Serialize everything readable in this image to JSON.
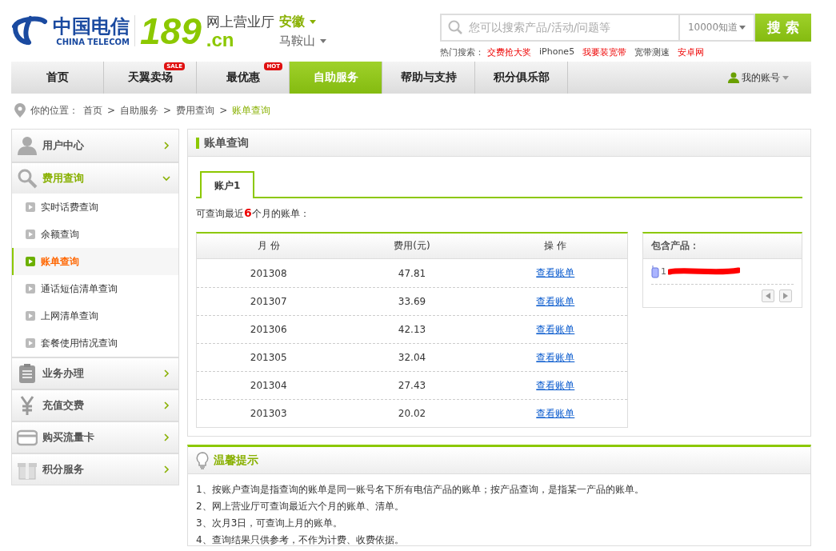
{
  "logo": {
    "brand_cn": "中国电信",
    "brand_en": "CHINA TELECOM",
    "number": "189",
    "domain": ".cn",
    "site_name": "网上营业厅"
  },
  "region": {
    "province": "安徽",
    "city": "马鞍山"
  },
  "search": {
    "placeholder": "您可以搜索产品/活动/问题等",
    "scope": "10000知道",
    "button": "搜 索"
  },
  "hot_searches": {
    "label": "热门搜索：",
    "items": [
      {
        "text": "交费抢大奖",
        "highlighted": true
      },
      {
        "text": "iPhone5",
        "highlighted": false
      },
      {
        "text": "我要装宽带",
        "highlighted": true
      },
      {
        "text": "宽带测速",
        "highlighted": false
      },
      {
        "text": "安卓网",
        "highlighted": true
      }
    ]
  },
  "nav": {
    "items": [
      {
        "label": "首页",
        "selected": false
      },
      {
        "label": "天翼卖场",
        "badge": "SALE",
        "selected": false
      },
      {
        "label": "最优惠",
        "badge": "HOT",
        "selected": false
      },
      {
        "label": "自助服务",
        "selected": true
      },
      {
        "label": "帮助与支持",
        "selected": false
      },
      {
        "label": "积分俱乐部",
        "selected": false
      }
    ],
    "account": "我的账号"
  },
  "breadcrumb": {
    "label": "你的位置：",
    "separator": ">",
    "items": [
      "首页",
      "自助服务",
      "费用查询",
      "账单查询"
    ]
  },
  "sidebar": [
    {
      "title": "用户中心",
      "expanded": false
    },
    {
      "title": "费用查询",
      "expanded": true,
      "children": [
        {
          "label": "实时话费查询",
          "selected": false
        },
        {
          "label": "余额查询",
          "selected": false
        },
        {
          "label": "账单查询",
          "selected": true
        },
        {
          "label": "通话短信清单查询",
          "selected": false
        },
        {
          "label": "上网清单查询",
          "selected": false
        },
        {
          "label": "套餐使用情况查询",
          "selected": false
        }
      ]
    },
    {
      "title": "业务办理",
      "expanded": false
    },
    {
      "title": "充值交费",
      "expanded": false
    },
    {
      "title": "购买流量卡",
      "expanded": false
    },
    {
      "title": "积分服务",
      "expanded": false
    }
  ],
  "bill_panel": {
    "title": "账单查询",
    "tabs": [
      {
        "label": "账户1",
        "selected": true
      }
    ],
    "note": "可查询最近**6**个月的账单：",
    "table": {
      "columns": [
        "月 份",
        "费用(元)",
        "操 作"
      ],
      "rows": [
        {
          "month": "201308",
          "amount": "47.81",
          "action": "查看账单"
        },
        {
          "month": "201307",
          "amount": "33.69",
          "action": "查看账单"
        },
        {
          "month": "201306",
          "amount": "42.13",
          "action": "查看账单"
        },
        {
          "month": "201305",
          "amount": "32.04",
          "action": "查看账单"
        },
        {
          "month": "201304",
          "amount": "27.43",
          "action": "查看账单"
        },
        {
          "month": "201303",
          "amount": "20.02",
          "action": "查看账单"
        }
      ]
    },
    "products": {
      "title": "包含产品：",
      "items": [
        {
          "number": "1"
        }
      ]
    }
  },
  "tips": {
    "title": "温馨提示",
    "items": [
      "1、按账户查询是指查询的账单是同一账号名下所有电信产品的账单；按产品查询，是指某一产品的账单。",
      "2、网上营业厅可查询最近六个月的账单、清单。",
      "3、次月3日，可查询上月的账单。",
      "4、查询结果只供参考，不作为计费、收费依据。"
    ]
  }
}
